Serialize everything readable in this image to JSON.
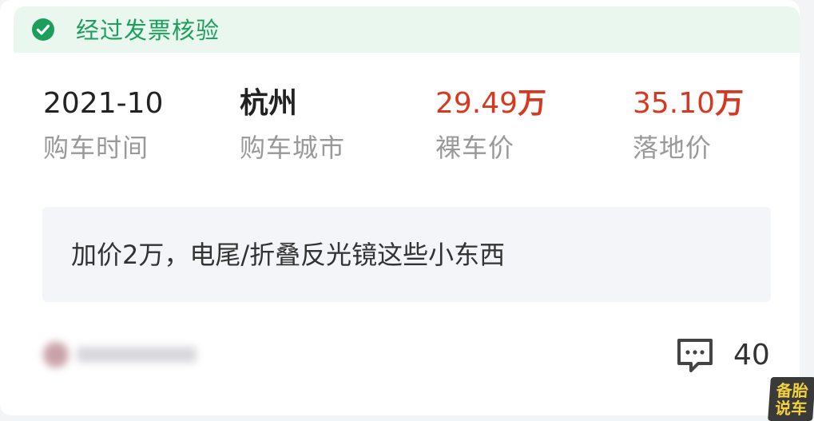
{
  "verify_banner": {
    "text": "经过发票核验",
    "accent_color": "#1c9f5b",
    "background_color": "#e9f7ef",
    "icon": "check-circle-icon"
  },
  "stats": {
    "purchase_time": {
      "value": "2021-10",
      "label": "购车时间"
    },
    "purchase_city": {
      "value": "杭州",
      "label": "购车城市"
    },
    "bare_price": {
      "value": "29.49",
      "unit": "万",
      "label": "裸车价"
    },
    "total_price": {
      "value": "35.10",
      "unit": "万",
      "label": "落地价"
    },
    "price_color": "#d8381f"
  },
  "note": {
    "text": "加价2万，电尾/折叠反光镜这些小东西"
  },
  "footer": {
    "comment_icon": "comment-dots-icon",
    "comment_count": "40"
  },
  "watermark": {
    "line1": "备胎",
    "line2": "说车"
  }
}
